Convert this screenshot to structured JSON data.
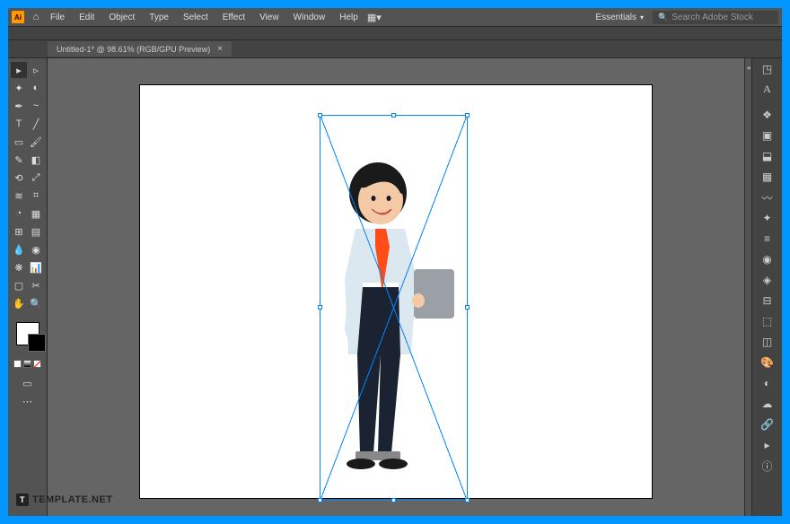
{
  "menubar": {
    "logo": "Ai",
    "items": [
      "File",
      "Edit",
      "Object",
      "Type",
      "Select",
      "Effect",
      "View",
      "Window",
      "Help"
    ],
    "workspace": "Essentials",
    "search_placeholder": "Search Adobe Stock"
  },
  "tab": {
    "title": "Untitled-1* @ 98.61% (RGB/GPU Preview)"
  },
  "tools_left": [
    [
      "selection",
      "direct-selection"
    ],
    [
      "magic-wand",
      "lasso"
    ],
    [
      "pen",
      "curvature"
    ],
    [
      "type",
      "line-segment"
    ],
    [
      "rectangle",
      "paintbrush"
    ],
    [
      "shaper",
      "eraser"
    ],
    [
      "rotate",
      "scale"
    ],
    [
      "width",
      "free-transform"
    ],
    [
      "shape-builder",
      "perspective"
    ],
    [
      "mesh",
      "gradient"
    ],
    [
      "eyedropper",
      "blend"
    ],
    [
      "symbol-sprayer",
      "column-graph"
    ],
    [
      "artboard",
      "slice"
    ],
    [
      "hand",
      "zoom"
    ]
  ],
  "panel_icons_top": [
    "properties",
    "type-character"
  ],
  "panel_icons": [
    "layers",
    "artboards",
    "asset-export",
    "swatches",
    "brushes",
    "symbols",
    "stroke",
    "appearance",
    "graphic-styles",
    "align",
    "transform",
    "pathfinder",
    "color",
    "color-guide",
    "libraries",
    "links",
    "actions",
    "document-info"
  ],
  "watermark": {
    "icon": "T",
    "text": "TEMPLATE.NET"
  },
  "artwork": {
    "description": "businessman-with-laptop-illustration"
  }
}
